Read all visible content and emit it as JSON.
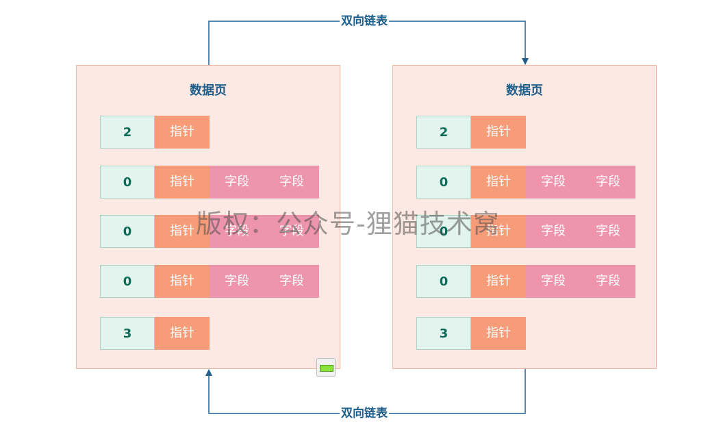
{
  "link_label_top": "双向链表",
  "link_label_bottom": "双向链表",
  "watermark": "版权：公众号-狸猫技术窝",
  "colors": {
    "page_bg": "#fde9e3",
    "page_border": "#f2b7a4",
    "slot_bg": "#e3f4ee",
    "pointer_bg": "#f79c78",
    "field_bg": "#ee94ad",
    "link_color": "#1f5f8b"
  },
  "pages": [
    {
      "title": "数据页",
      "rows": [
        {
          "slot": "2",
          "pointer": "指针",
          "fields": []
        },
        {
          "slot": "0",
          "pointer": "指针",
          "fields": [
            "字段",
            "字段"
          ]
        },
        {
          "slot": "0",
          "pointer": "指针",
          "fields": [
            "字段",
            "字段"
          ]
        },
        {
          "slot": "0",
          "pointer": "指针",
          "fields": [
            "字段",
            "字段"
          ]
        },
        {
          "slot": "3",
          "pointer": "指针",
          "fields": []
        }
      ]
    },
    {
      "title": "数据页",
      "rows": [
        {
          "slot": "2",
          "pointer": "指针",
          "fields": []
        },
        {
          "slot": "0",
          "pointer": "指针",
          "fields": [
            "字段",
            "字段"
          ]
        },
        {
          "slot": "0",
          "pointer": "指针",
          "fields": [
            "字段",
            "字段"
          ]
        },
        {
          "slot": "0",
          "pointer": "指针",
          "fields": [
            "字段",
            "字段"
          ]
        },
        {
          "slot": "3",
          "pointer": "指针",
          "fields": []
        }
      ]
    }
  ],
  "battery_icon": "battery-icon"
}
